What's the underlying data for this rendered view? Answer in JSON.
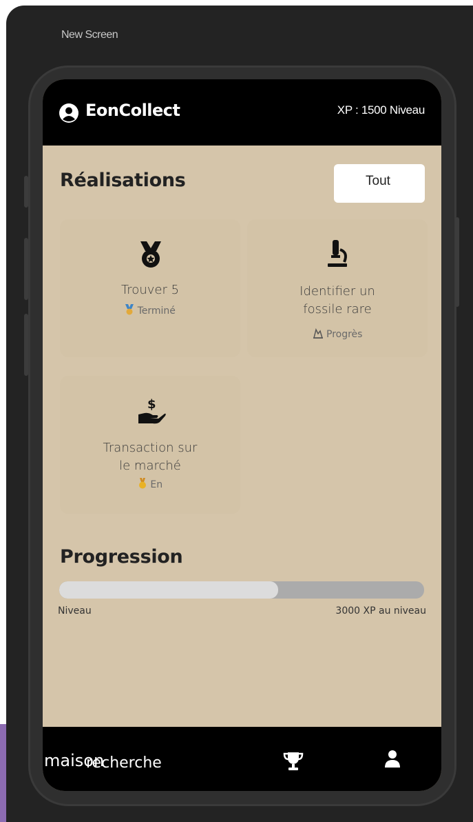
{
  "editor": {
    "screen_label": "New Screen"
  },
  "header": {
    "app_title": "EonCollect",
    "xp_level": "XP : 1500 Niveau"
  },
  "achievements": {
    "section_title": "Réalisations",
    "filter_label": "Tout",
    "items": [
      {
        "title": "Trouver 5",
        "status": "Terminé",
        "icon": "medal-icon",
        "status_icon": "ribbon-medal-icon"
      },
      {
        "title": "Identifier un fossile rare",
        "status": "Progrès",
        "icon": "microscope-icon",
        "status_icon": "progress-icon"
      },
      {
        "title": "Transaction sur le marché",
        "status": "En",
        "icon": "hand-dollar-icon",
        "status_icon": "gold-medal-icon"
      }
    ]
  },
  "progress": {
    "section_title": "Progression",
    "fraction": 0.6,
    "left_label": "Niveau",
    "right_label": "3000 XP au niveau"
  },
  "nav": {
    "home_label": "maison",
    "search_label": "recherche",
    "trophy_icon": "trophy-icon",
    "profile_icon": "user-icon"
  },
  "colors": {
    "header_bg": "#000000",
    "screen_bg": "#d5c5aa",
    "progress_track": "#ababab",
    "progress_fill": "#dcdcdc"
  }
}
